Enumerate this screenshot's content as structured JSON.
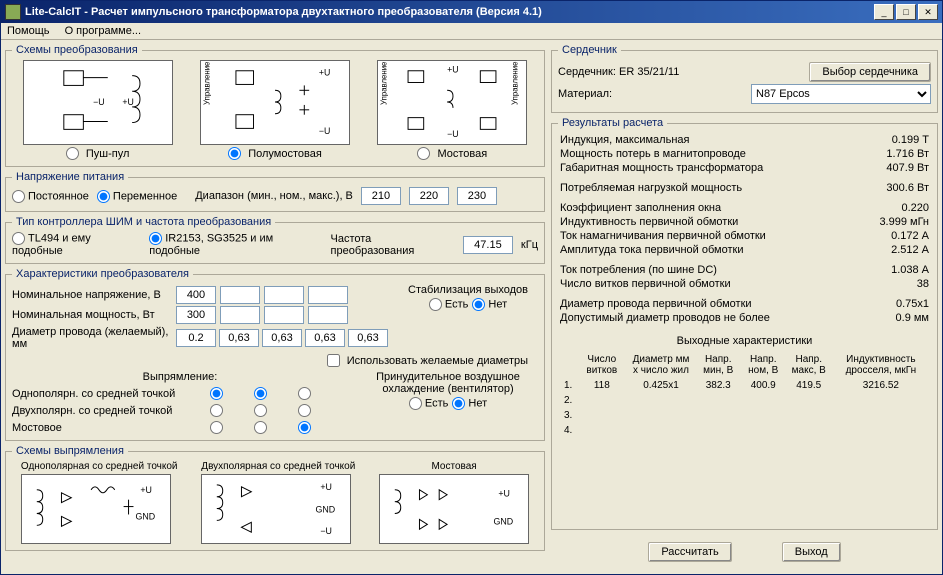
{
  "window": {
    "title": "Lite-CalcIT - Расчет импульсного трансформатора двухтактного преобразователя (Версия 4.1)"
  },
  "menu": {
    "help": "Помощь",
    "about": "О программе..."
  },
  "schemes": {
    "legend": "Схемы преобразования",
    "push_pull": "Пуш-пул",
    "half_bridge": "Полумостовая",
    "bridge": "Мостовая"
  },
  "supply": {
    "legend": "Напряжение питания",
    "dc": "Постоянное",
    "ac": "Переменное",
    "range_label": "Диапазон (мин., ном., макс.), В",
    "min": "210",
    "nom": "220",
    "max": "230"
  },
  "controller": {
    "legend": "Тип контроллера ШИМ и частота преобразования",
    "tl494": "TL494 и ему подобные",
    "ir2153": "IR2153, SG3525 и им подобные",
    "freq_label": "Частота преобразования",
    "freq": "47.15",
    "freq_unit": "кГц"
  },
  "converter": {
    "legend": "Характеристики преобразователя",
    "voltage_label": "Номинальное напряжение, В",
    "voltage": "400",
    "power_label": "Номинальная мощность, Вт",
    "power": "300",
    "diameter_label": "Диаметр провода (желаемый), мм",
    "diam": [
      "0.2",
      "0,63",
      "0,63",
      "0,63",
      "0,63"
    ],
    "use_diam": "Использовать желаемые диаметры",
    "stab_legend": "Стабилизация выходов",
    "yes": "Есть",
    "no": "Нет",
    "rect_legend": "Выпрямление:",
    "unipolar": "Однополярн. со средней точкой",
    "bipolar": "Двухполярн. со средней точкой",
    "bridge": "Мостовое",
    "cooling_legend": "Принудительное воздушное охлаждение (вентилятор)"
  },
  "rect_schemes": {
    "legend": "Схемы выпрямления",
    "unipolar": "Однополярная со средней точкой",
    "bipolar": "Двухполярная со средней точкой",
    "bridge": "Мостовая"
  },
  "core": {
    "legend": "Сердечник",
    "core_label": "Сердечник:",
    "core_value": "ER 35/21/11",
    "select_btn": "Выбор сердечника",
    "material_label": "Материал:",
    "material_value": "N87 Epcos"
  },
  "results": {
    "legend": "Результаты расчета",
    "rows": [
      {
        "label": "Индукция, максимальная",
        "value": "0.199 Т"
      },
      {
        "label": "Мощность потерь в магнитопроводе",
        "value": "1.716 Вт"
      },
      {
        "label": "Габаритная мощность трансформатора",
        "value": "407.9 Вт"
      },
      {
        "label": "Потребляемая нагрузкой мощность",
        "value": "300.6 Вт"
      },
      {
        "label": "Коэффициент заполнения окна",
        "value": "0.220"
      },
      {
        "label": "Индуктивность первичной обмотки",
        "value": "3.999 мГн"
      },
      {
        "label": "Ток намагничивания первичной обмотки",
        "value": "0.172 А"
      },
      {
        "label": "Амплитуда тока первичной обмотки",
        "value": "2.512 А"
      },
      {
        "label": "Ток потребления (по шине DC)",
        "value": "1.038 А"
      },
      {
        "label": "Число витков первичной обмотки",
        "value": "38"
      },
      {
        "label": "Диаметр провода первичной обмотки",
        "value": "0.75x1"
      },
      {
        "label": "Допустимый диаметр проводов не более",
        "value": "0.9 мм"
      }
    ],
    "output_legend": "Выходные характеристики",
    "headers": {
      "n": "",
      "turns": "Число витков",
      "diam": "Диаметр мм x число жил",
      "vmin": "Напр. мин, В",
      "vnom": "Напр. ном, В",
      "vmax": "Напр. макс, В",
      "ind": "Индуктивность дросселя, мкГн"
    },
    "outputs": [
      {
        "n": "1.",
        "turns": "118",
        "diam": "0.425x1",
        "vmin": "382.3",
        "vnom": "400.9",
        "vmax": "419.5",
        "ind": "3216.52"
      },
      {
        "n": "2.",
        "turns": "",
        "diam": "",
        "vmin": "",
        "vnom": "",
        "vmax": "",
        "ind": ""
      },
      {
        "n": "3.",
        "turns": "",
        "diam": "",
        "vmin": "",
        "vnom": "",
        "vmax": "",
        "ind": ""
      },
      {
        "n": "4.",
        "turns": "",
        "diam": "",
        "vmin": "",
        "vnom": "",
        "vmax": "",
        "ind": ""
      }
    ]
  },
  "buttons": {
    "calculate": "Рассчитать",
    "exit": "Выход"
  }
}
